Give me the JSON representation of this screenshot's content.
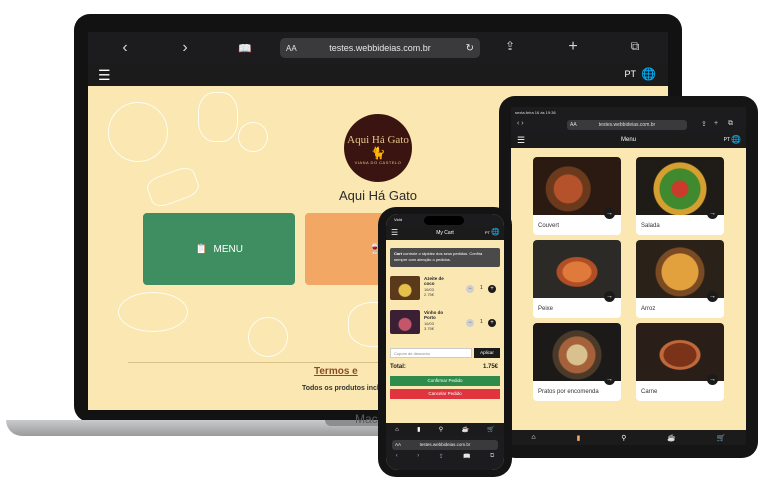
{
  "laptop": {
    "brand": "MacB",
    "browser": {
      "back": "‹",
      "forward": "›",
      "aa": "AA",
      "url": "testes.webbideias.com.br",
      "reload": "↻",
      "share": "⇪",
      "add": "+",
      "tabs": "⧉",
      "reader": "📖"
    },
    "app_bar": {
      "menu": "☰",
      "lang": "PT",
      "globe": "🌐"
    },
    "logo": {
      "line1": "Aqui Há Gato",
      "line2": "VIANA DO CASTELO",
      "cat": "🐈"
    },
    "title": "Aqui Há Gato",
    "tile_menu": {
      "icon": "📋",
      "label": "MENU"
    },
    "tile_wine": {
      "icon": "🍷",
      "label": "B"
    },
    "terms": "Termos e",
    "foot_note": "Todos os produtos inclu"
  },
  "tablet": {
    "status": "sexta-feira 16 às 19:36",
    "browser": {
      "aa": "AA",
      "url": "testes.webbideias.com.br",
      "nav": "‹ ›"
    },
    "app_bar": {
      "menu": "☰",
      "title": "Menu",
      "lang": "PT",
      "globe": "🌐"
    },
    "categories": [
      "Couvert",
      "Salada",
      "Peixe",
      "Arroz",
      "Pratos por encomenda",
      "Carne"
    ],
    "arrow": "→",
    "bottom_nav": [
      "⌂",
      "▮",
      "⚲",
      "☕",
      "🛒"
    ]
  },
  "phone": {
    "status": "Vidd",
    "app_bar": {
      "menu": "☰",
      "title": "My Cart",
      "lang": "PT",
      "globe": "🌐"
    },
    "notice_bold": "Cart",
    "notice_text": " controle o rápidez dos seus pedidos. Confira sempre com atenção o pedidos.",
    "items": [
      {
        "name": "Azeite de coco",
        "date": "16/03",
        "price": "2.75€",
        "qty": "1"
      },
      {
        "name": "Vinho do Porto",
        "date": "16/03",
        "price": "3.75€",
        "qty": "1"
      }
    ],
    "minus": "−",
    "plus": "+",
    "coupon_placeholder": "Cupom de desconto",
    "apply_label": "Aplicar",
    "total_label": "Total:",
    "total_value": "1.75€",
    "confirm_label": "Confirmar Pedido",
    "cancel_label": "Cancelar Pedido",
    "bottom_nav": [
      "⌂",
      "▮",
      "⚲",
      "☕",
      "🛒"
    ],
    "browser": {
      "aa": "AA",
      "url": "testes.webbideias.com.br"
    },
    "browser_nav": [
      "‹",
      "›",
      "⇪",
      "📖",
      "⧉"
    ]
  },
  "colors": {
    "cream": "#fae7b1",
    "green": "#3f8e61",
    "orange": "#f3a765",
    "dark": "#1b1b1b",
    "red": "#e0343f"
  }
}
